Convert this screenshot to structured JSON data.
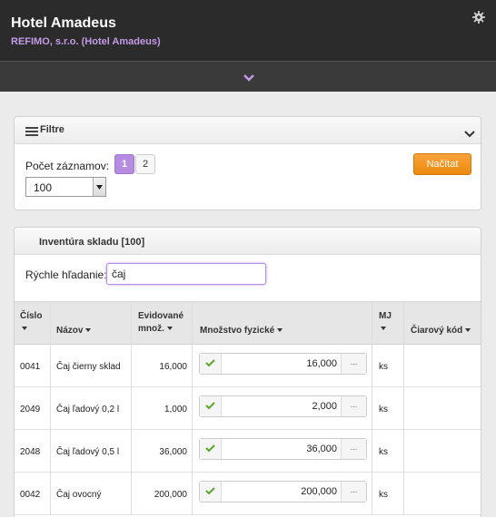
{
  "header": {
    "title": "Hotel Amadeus",
    "subtitle": "REFIMO, s.r.o. (Hotel Amadeus)",
    "settings_icon": "gear-icon",
    "expand_icon": "chevron-down-icon"
  },
  "colors": {
    "accent": "#b58ce0",
    "action": "#ef8f14",
    "header_bg": "#2b2b2b"
  },
  "filter": {
    "title": "Filtre",
    "count_label": "Počet záznamov:",
    "pages": [
      "1",
      "2"
    ],
    "active_page": "1",
    "load_button": "Načítat",
    "records_per_page": "100"
  },
  "inventory": {
    "title": "Inventúra skladu  [100]",
    "search_label": "Rýchle hľadanie:",
    "search_value": "čaj",
    "columns": {
      "cislo": "Číslo",
      "nazov": "Názov",
      "evidovane_1": "Evidované",
      "evidovane_2": "množ.",
      "mnozstvo": "Množstvo fyzické",
      "mj": "MJ",
      "ciarovy": "Čiarový kód"
    },
    "more_button": "...",
    "rows": [
      {
        "cislo": "0041",
        "nazov": "Čaj čierny sklad",
        "evidovane": "16,000",
        "fyzicke": "16,000",
        "mj": "ks"
      },
      {
        "cislo": "2049",
        "nazov": "Čaj ľadový 0,2 l",
        "evidovane": "1,000",
        "fyzicke": "2,000",
        "mj": "ks"
      },
      {
        "cislo": "2048",
        "nazov": "Čaj ľadový 0,5 l",
        "evidovane": "36,000",
        "fyzicke": "36,000",
        "mj": "ks"
      },
      {
        "cislo": "0042",
        "nazov": "Čaj ovocný",
        "evidovane": "200,000",
        "fyzicke": "200,000",
        "mj": "ks"
      }
    ]
  }
}
